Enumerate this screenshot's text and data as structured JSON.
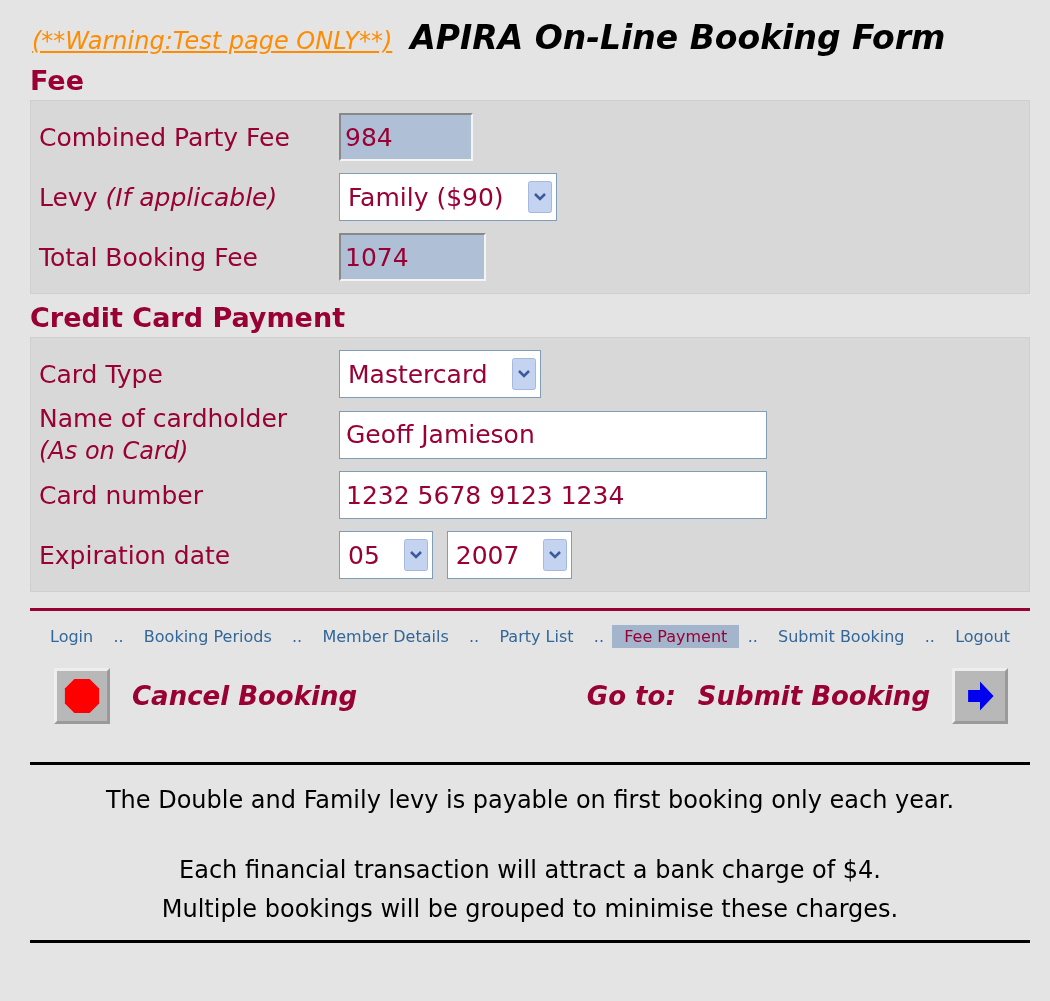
{
  "header": {
    "warning": "(**Warning:Test page ONLY**)",
    "title": "APIRA On-Line Booking Form"
  },
  "sections": [
    {
      "heading": "Fee",
      "rows": [
        {
          "label": "Combined Party Fee",
          "fields": [
            {
              "kind": "readonly",
              "value": "984"
            }
          ]
        },
        {
          "label": "Levy *(If applicable)*",
          "fields": [
            {
              "kind": "select",
              "value": "Family ($90)"
            }
          ]
        },
        {
          "label": "Total Booking Fee",
          "fields": [
            {
              "kind": "readonly",
              "value": "1074"
            }
          ]
        }
      ]
    },
    {
      "heading": "Credit Card Payment",
      "rows": [
        {
          "label": "Card Type",
          "fields": [
            {
              "kind": "select",
              "value": "Mastercard"
            }
          ]
        },
        {
          "label": "Name of cardholder",
          "note": "(As on Card)",
          "fields": [
            {
              "kind": "text",
              "value": "Geoff Jamieson"
            }
          ]
        },
        {
          "label": "Card number",
          "fields": [
            {
              "kind": "text",
              "value": "1232 5678 9123 1234"
            }
          ]
        },
        {
          "label": "Expiration date",
          "fields": [
            {
              "kind": "select",
              "value": "05"
            },
            {
              "kind": "select",
              "value": "2007"
            }
          ]
        }
      ]
    }
  ],
  "nav": [
    {
      "label": "Login",
      "selected": false
    },
    {
      "label": "Booking Periods",
      "selected": false
    },
    {
      "label": "Member Details",
      "selected": false
    },
    {
      "label": "Party List",
      "selected": false
    },
    {
      "label": "Fee Payment",
      "selected": true
    },
    {
      "label": "Submit Booking",
      "selected": false
    },
    {
      "label": "Logout",
      "selected": false
    }
  ],
  "nav_separator": "..",
  "actions": {
    "cancel": "Cancel Booking",
    "goto_prefix": "Go to:",
    "goto": "Submit Booking"
  },
  "notes": [
    [
      "The Double and Family levy is payable on first booking only each year."
    ],
    [
      "Each financial transaction will attract a bank charge of $4.",
      "Multiple bookings will be grouped to minimise these charges."
    ]
  ]
}
